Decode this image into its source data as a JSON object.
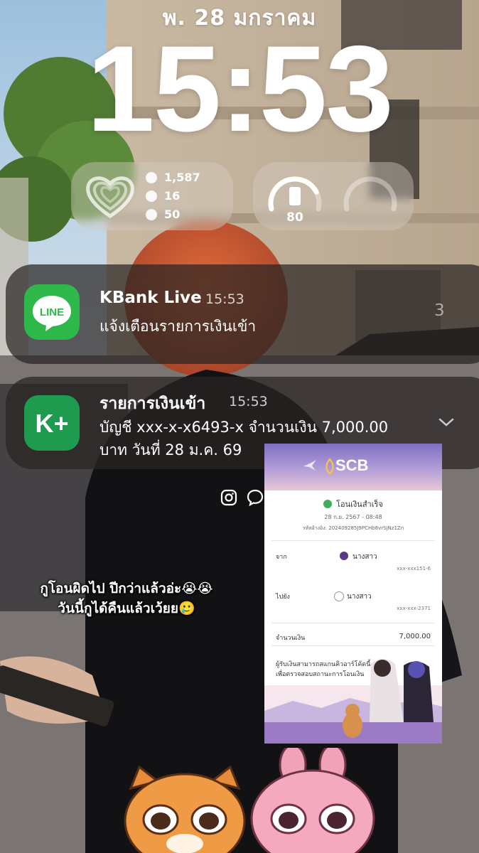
{
  "lockscreen": {
    "date": "พ. 28 มกราคม",
    "time": "15:53"
  },
  "widgets": {
    "activity": {
      "steps": "1,587",
      "minutes": "16",
      "calories": "50"
    },
    "battery": {
      "percent": "80"
    }
  },
  "notifications": [
    {
      "app_icon": "line-icon",
      "title": "KBank Live",
      "time": "15:53",
      "body": "แจ้งเตือนรายการเงินเข้า",
      "count": "3"
    },
    {
      "app_icon": "kplus-icon",
      "title": "รายการเงินเข้า",
      "time": "15:53",
      "body_line1": "บัญชี xxx-x-x6493-x  จำนวนเงิน 7,000.00",
      "body_line2": "บาท  วันที่ 28 ม.ค. 69"
    }
  ],
  "caption": {
    "line1": "กูโอนผิดไป ปีกว่าแล้วอ่ะ😭😭",
    "line2": "วันนี้กูได้คืนแล้วเว้ยย🥲"
  },
  "slip": {
    "bank": "SCB",
    "status": "โอนเงินสำเร็จ",
    "datetime": "28 ก.ย. 2567 - 08:48",
    "ref": "รหัสอ้างอิง: 202409285J9PCHb8vrSjNz1Zn",
    "from_label": "จาก",
    "from_name": "นางสาว",
    "from_account": "xxx-xxx151-6",
    "to_label": "ไปยัง",
    "to_name": "นางสาว",
    "to_account": "xxx-xxx-2371",
    "amount_label": "จำนวนเงิน",
    "amount": "7,000.00",
    "note": "ผู้รับเงินสามารถสแกนคิวอาร์โค้ดนี้เพื่อตรวจสอบสถานะการโอนเงิน"
  },
  "colors": {
    "line_green": "#2fb84a",
    "kplus_green": "#1f9b4f",
    "scb_purple": "#7f6fc2",
    "success_green": "#3fae5a"
  }
}
